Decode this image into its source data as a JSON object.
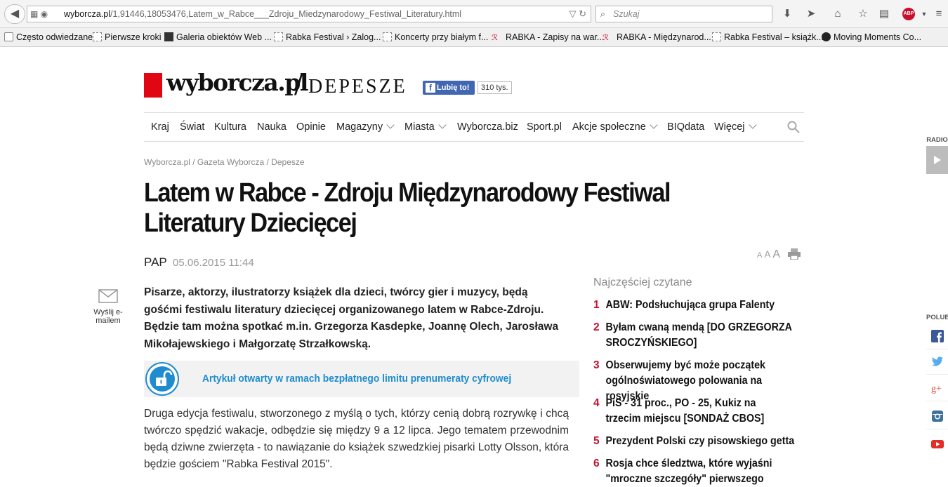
{
  "browser": {
    "url_domain": "wyborcza.pl",
    "url_path": "/1,91446,18053476,Latem_w_Rabce___Zdroju_Miedzynarodowy_Festiwal_Literatury.html",
    "search_placeholder": "Szukaj",
    "bookmarks": [
      "Często odwiedzane",
      "Pierwsze kroki",
      "Galeria obiektów Web ...",
      "Rabka Festival › Zalog...",
      "Koncerty przy białym f...",
      "RABKA - Zapisy na war...",
      "RABKA - Międzynarod...",
      "Rabka Festival – książk...",
      "Moving Moments Co..."
    ]
  },
  "site": {
    "logo_text": "wyborcza.pl",
    "section": "DEPESZE",
    "fb_like": "Lubię to!",
    "fb_count": "310 tys."
  },
  "nav": {
    "items": [
      "Kraj",
      "Świat",
      "Kultura",
      "Nauka",
      "Opinie",
      "Magazyny",
      "Miasta",
      "Wyborcza.biz",
      "Sport.pl",
      "Akcje społeczne",
      "BIQdata",
      "Więcej"
    ]
  },
  "breadcrumb": "Wyborcza.pl / Gazeta Wyborcza / Depesze",
  "article": {
    "title": "Latem w Rabce - Zdroju Międzynarodowy Festiwal Literatury Dziecięcej",
    "author": "PAP",
    "date": "05.06.2015 11:44",
    "font_sizes": [
      "A",
      "A",
      "A"
    ],
    "lead": "Pisarze, aktorzy, ilustratorzy książek dla dzieci, twórcy gier i muzycy, będą gośćmi festiwalu literatury dziecięcej organizowanego latem w Rabce-Zdroju. Będzie tam można spotkać m.in. Grzegorza Kasdepke, Joannę Olech, Jarosława Mikołajewskiego i Małgorzatę Strzałkowską.",
    "promo": "Artykuł otwarty w ramach bezpłatnego limitu prenumeraty cyfrowej",
    "body": "Druga edycja festiwalu, stworzonego z myślą o tych, którzy cenią dobrą rozrywkę i chcą twórczo spędzić wakacje, odbędzie się między 9 a 12 lipca. Jego tematem przewodnim będą dziwne zwierzęta - to nawiązanie do książek szwedzkiej pisarki Lotty Olsson, która będzie gościem \"Rabka Festival 2015\"."
  },
  "share_mail": "Wyślij e-mailem",
  "popular": {
    "title": "Najczęściej czytane",
    "items": [
      {
        "num": "1",
        "text": "ABW: Podsłuchująca grupa Falenty"
      },
      {
        "num": "2",
        "text": "Byłam cwaną mendą [DO GRZEGORZA SROCZYŃSKIEGO]"
      },
      {
        "num": "3",
        "text": "Obserwujemy być może początek ogólnoświatowego polowania na rosyjskie"
      },
      {
        "num": "4",
        "text": "PiS - 31 proc., PO - 25, Kukiz na trzecim miejscu [SONDAŻ CBOS]"
      },
      {
        "num": "5",
        "text": "Prezydent Polski czy pisowskiego getta"
      },
      {
        "num": "6",
        "text": "Rosja chce śledztwa, które wyjaśni \"mroczne szczegóły\" pierwszego"
      }
    ]
  },
  "side": {
    "radio": "RADIO",
    "polub": "POLUB"
  },
  "colors": {
    "brand_red": "#e10613",
    "accent_blue": "#1f8ccf",
    "number_red": "#c8102e"
  }
}
